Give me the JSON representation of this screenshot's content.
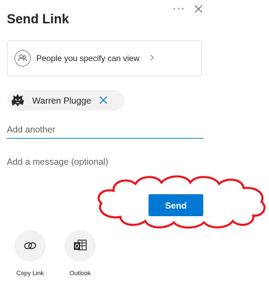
{
  "dialog": {
    "title": "Send Link",
    "more_icon": "more-options-icon",
    "close_icon": "close-icon"
  },
  "permission": {
    "label": "People you specify can view",
    "icon": "people-icon"
  },
  "recipient": {
    "name": "Warren Plugge",
    "remove_icon": "remove-icon"
  },
  "add_another": {
    "placeholder": "Add another",
    "value": ""
  },
  "message": {
    "placeholder": "Add a message (optional)",
    "value": ""
  },
  "send": {
    "label": "Send"
  },
  "share_options": [
    {
      "label": "Copy Link",
      "icon": "link-icon"
    },
    {
      "label": "Outlook",
      "icon": "outlook-icon"
    }
  ],
  "colors": {
    "accent": "#0078d4",
    "annotation": "#e8141b"
  }
}
